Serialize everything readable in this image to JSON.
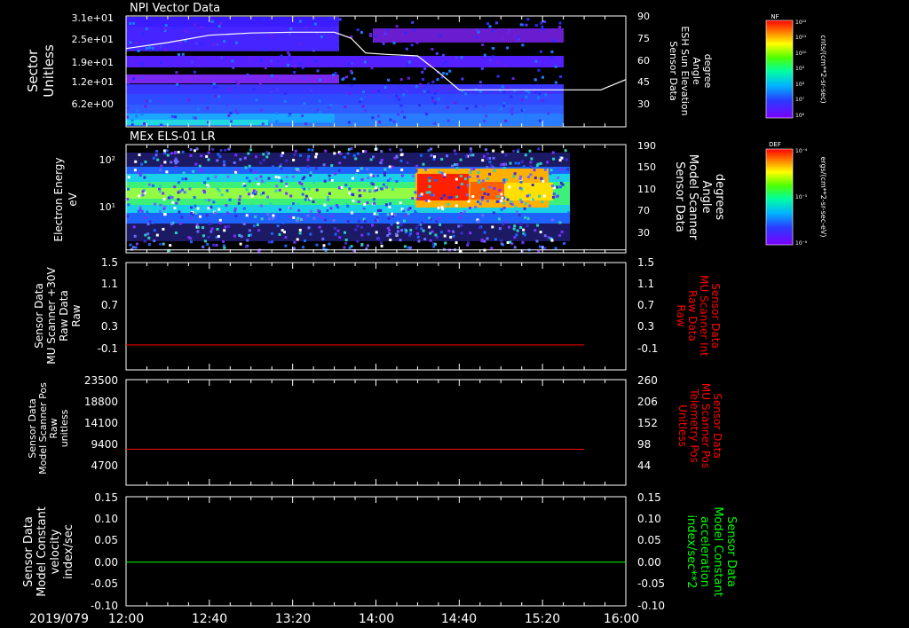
{
  "colors": {
    "background": "#000000",
    "axis": "#ffffff",
    "red_trace": "#ff0000",
    "green_trace": "#00ff00"
  },
  "time_axis": {
    "date_label": "2019/079",
    "ticks": [
      "12:00",
      "12:40",
      "13:20",
      "14:00",
      "14:40",
      "15:20",
      "16:00"
    ]
  },
  "chart_data": [
    {
      "id": "npi",
      "type": "heatmap",
      "title": "NPI Vector Data",
      "ylabel": [
        "Sector",
        "Unitless"
      ],
      "y_ticks": [
        "3.1e+01",
        "2.5e+01",
        "1.9e+01",
        "1.2e+01",
        "6.2e+00"
      ],
      "right_label": [
        "Sensor Data",
        "ESH Sun Elevation",
        "Angle",
        "degree"
      ],
      "right_ticks": [
        "90",
        "75",
        "60",
        "45",
        "30"
      ],
      "right_range": [
        15,
        90
      ],
      "overlay_line": {
        "name": "ESH Sun Elevation Angle",
        "x": [
          "12:00",
          "12:20",
          "12:40",
          "13:00",
          "13:20",
          "13:40",
          "13:48",
          "13:55",
          "14:05",
          "14:20",
          "14:30",
          "14:40",
          "15:00",
          "15:20",
          "15:40",
          "15:48",
          "16:00"
        ],
        "y": [
          68,
          72,
          77,
          78.5,
          79,
          79,
          75,
          65,
          64,
          63,
          52,
          40,
          40,
          40,
          40,
          40,
          47
        ]
      },
      "colorbar": {
        "label": "NF",
        "units": "cnts/(cm**2-sr-sec)",
        "ticks": [
          "10¹²",
          "10¹¹",
          "10¹⁰",
          "10⁹",
          "10⁸",
          "10⁷",
          "10⁶"
        ]
      }
    },
    {
      "id": "els",
      "type": "heatmap",
      "title": "MEx ELS-01 LR",
      "ylabel": [
        "Electron Energy",
        "eV"
      ],
      "y_ticks": [
        "10²",
        "10¹"
      ],
      "right_label": [
        "Sensor Data",
        "Model Scanner",
        "Angle",
        "degrees"
      ],
      "right_ticks": [
        "190",
        "150",
        "110",
        "70",
        "30"
      ],
      "right_range": [
        0,
        190
      ],
      "overlay_line": {
        "name": "Model Scanner Angle",
        "x": [
          "12:00",
          "16:00"
        ],
        "y": [
          5,
          5
        ]
      },
      "colorbar": {
        "label": "DEF",
        "units": "ergs/(cm**2-sr-sec-eV)",
        "ticks": [
          "10⁻⁴",
          "10⁻⁵",
          "10⁻⁶"
        ]
      }
    },
    {
      "id": "mu30v",
      "type": "line",
      "ylabel": [
        "Sensor Data",
        "MU Scanner +30V",
        "Raw Data",
        "Raw"
      ],
      "y_ticks": [
        "1.5",
        "1.1",
        "0.7",
        "0.3",
        "-0.1"
      ],
      "ylim": [
        -0.35,
        1.5
      ],
      "right_label": [
        "Sensor Data",
        "MU Scanner Int",
        "Raw Data",
        "Raw"
      ],
      "right_ticks": [
        "1.5",
        "1.1",
        "0.7",
        "0.3",
        "-0.1"
      ],
      "series": [
        {
          "color": "#ff0000",
          "x": [
            "12:00",
            "15:40"
          ],
          "y": [
            0.08,
            0.08
          ]
        }
      ]
    },
    {
      "id": "mupos",
      "type": "line",
      "ylabel": [
        "Sensor Data",
        "Model Scanner Pos",
        "Raw",
        "unitless"
      ],
      "y_ticks": [
        "23500",
        "18800",
        "14100",
        "9400",
        "4700"
      ],
      "ylim": [
        0,
        23500
      ],
      "right_label": [
        "Sensor Data",
        "MU Scanner Pos",
        "Telemetry Pos",
        "Unitless"
      ],
      "right_ticks": [
        "260",
        "206",
        "152",
        "98",
        "44"
      ],
      "series": [
        {
          "color": "#ff0000",
          "x": [
            "12:00",
            "15:40"
          ],
          "y": [
            8000,
            8000
          ]
        }
      ]
    },
    {
      "id": "model_const",
      "type": "line",
      "ylabel": [
        "Sensor Data",
        "Model Constant",
        "velocity",
        "index/sec"
      ],
      "y_ticks": [
        "0.15",
        "0.10",
        "0.05",
        "0.00",
        "-0.05",
        "-0.10"
      ],
      "ylim": [
        -0.1,
        0.15
      ],
      "right_label": [
        "Sensor Data",
        "Model Constant",
        "acceleration",
        "index/sec**2"
      ],
      "right_ticks": [
        "0.15",
        "0.10",
        "0.05",
        "0.00",
        "-0.05",
        "-0.10"
      ],
      "series": [
        {
          "color": "#00ff00",
          "x": [
            "12:00",
            "16:00"
          ],
          "y": [
            0,
            0
          ]
        }
      ]
    }
  ]
}
